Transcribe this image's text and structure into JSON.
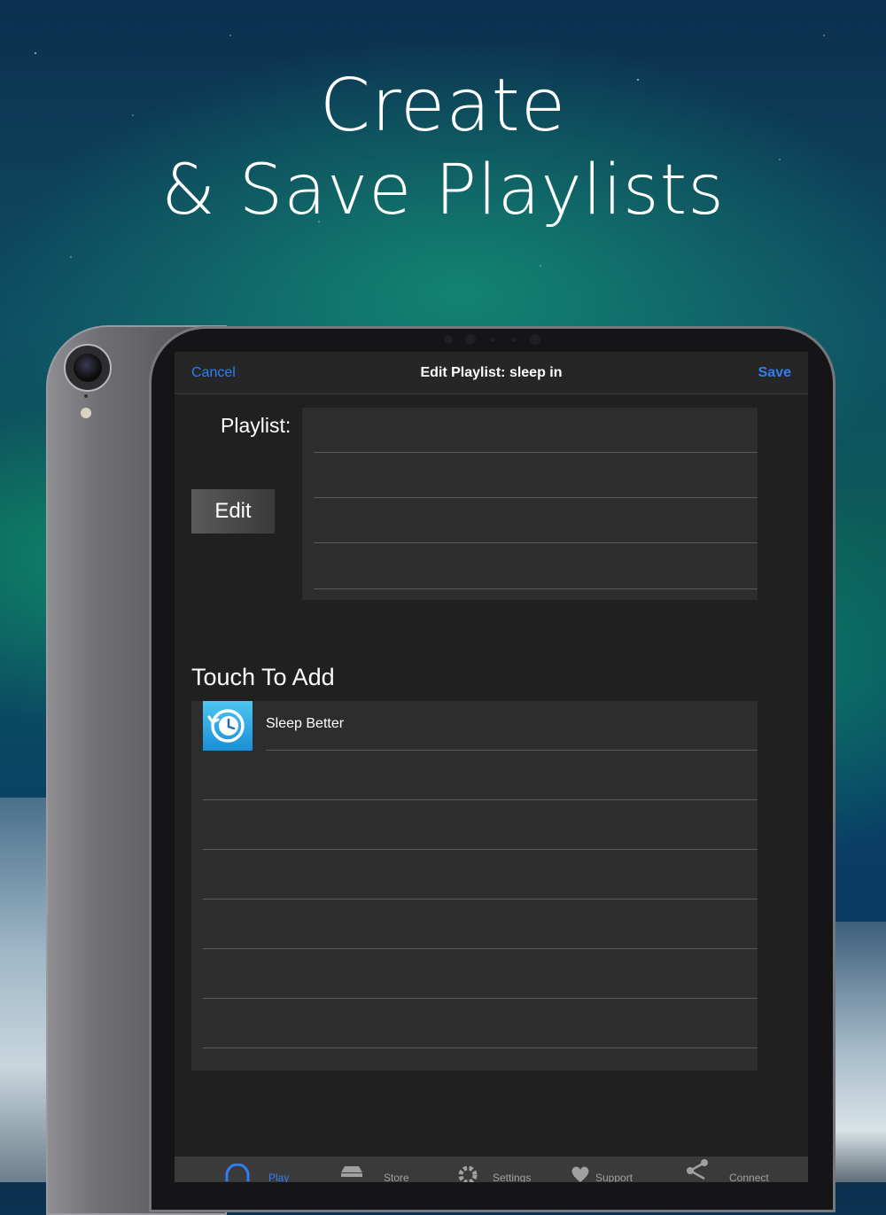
{
  "headline": {
    "line1": "Create",
    "line2": "& Save Playlists"
  },
  "navbar": {
    "cancel": "Cancel",
    "title": "Edit Playlist: sleep in",
    "save": "Save"
  },
  "playlist": {
    "label": "Playlist:",
    "edit_button": "Edit",
    "items": [
      "",
      "",
      "",
      ""
    ]
  },
  "touch_to_add": {
    "title": "Touch To Add",
    "items": [
      {
        "label": "Sleep Better",
        "icon": "clock-rewind-icon"
      }
    ]
  },
  "tabbar": {
    "items": [
      {
        "label": "Play",
        "icon": "headphones-icon",
        "active": true
      },
      {
        "label": "Store",
        "icon": "cart-icon",
        "active": false
      },
      {
        "label": "Settings",
        "icon": "gear-icon",
        "active": false
      },
      {
        "label": "Support",
        "icon": "heart-icon",
        "active": false
      },
      {
        "label": "Connect",
        "icon": "share-icon",
        "active": false
      }
    ]
  },
  "colors": {
    "accent": "#2f7ef5",
    "panel": "#2d2d2d",
    "screen": "#202020"
  }
}
